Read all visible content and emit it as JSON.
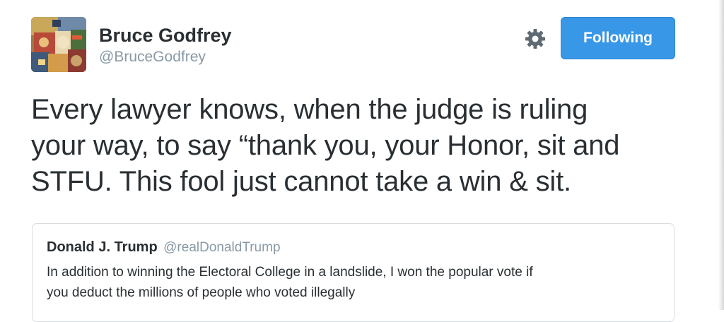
{
  "author": {
    "display_name": "Bruce Godfrey",
    "handle": "@BruceGodfrey"
  },
  "actions": {
    "settings_icon": "gear-icon",
    "follow_label": "Following",
    "follow_color": "#3897e6"
  },
  "tweet": {
    "lines": [
      "Every lawyer knows, when the judge is ruling",
      "your way, to say “thank you, your Honor, sit and",
      "STFU. This fool just cannot take a win & sit."
    ]
  },
  "quoted_tweet": {
    "display_name": "Donald J. Trump",
    "handle": "@realDonaldTrump",
    "lines": [
      "In addition to winning the Electoral College in a landslide, I won the popular vote if",
      "you deduct the millions of people who voted illegally"
    ]
  }
}
